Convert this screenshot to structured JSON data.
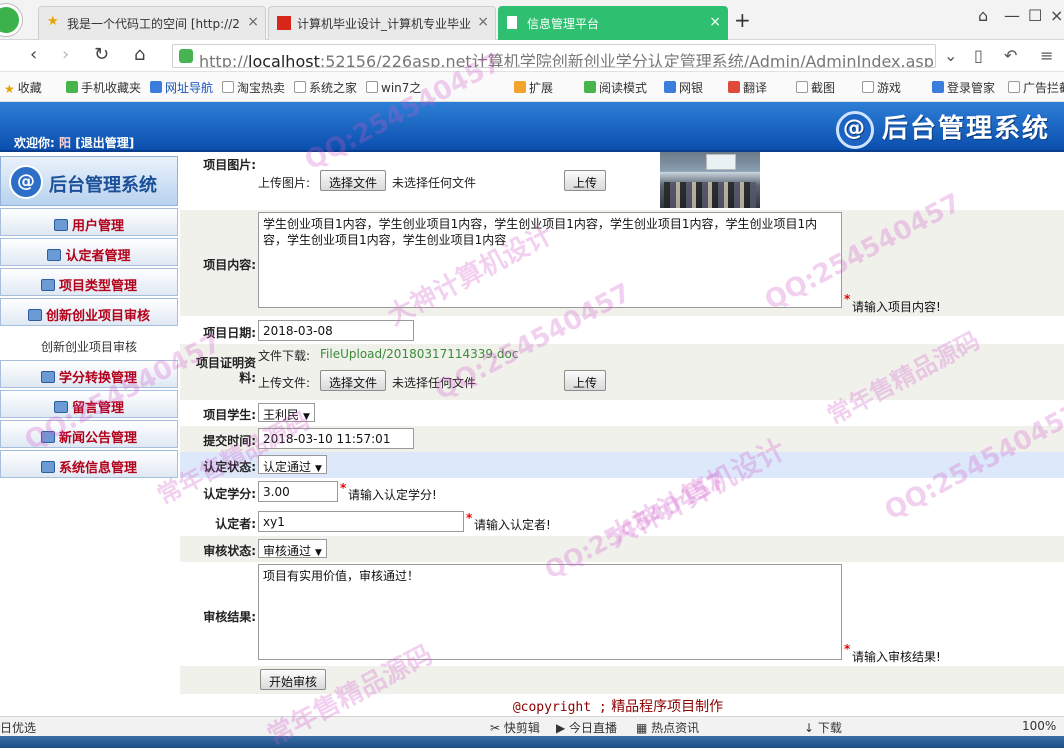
{
  "browser": {
    "tabs": [
      {
        "label": "我是一个代码工的空间 [http://2",
        "active": false
      },
      {
        "label": "计算机毕业设计_计算机专业毕业",
        "active": false
      },
      {
        "label": "信息管理平台",
        "active": true
      }
    ],
    "url_prefix": "http://",
    "url_host": "localhost",
    "url_rest": ":52156/226asp.net计算机学院创新创业学分认定管理系统/Admin/AdminIndex.aspx",
    "bookmarks": [
      "收藏",
      "手机收藏夹",
      "网址导航",
      "淘宝热卖",
      "系统之家",
      "win7之",
      "扩展",
      "阅读模式",
      "网银",
      "翻译",
      "截图",
      "游戏",
      "登录管家",
      "广告拦截"
    ]
  },
  "header": {
    "welcome_label": "欢迎你:",
    "username": "阳",
    "logout": "[退出管理]",
    "brand_title": "后台管理系统"
  },
  "sidebar": {
    "brand_title": "后台管理系统",
    "items": [
      {
        "label": "用户管理"
      },
      {
        "label": "认定者管理"
      },
      {
        "label": "项目类型管理"
      },
      {
        "label": "创新创业项目审核"
      },
      {
        "label": "创新创业项目审核",
        "sub": true
      },
      {
        "label": "学分转换管理"
      },
      {
        "label": "留言管理"
      },
      {
        "label": "新闻公告管理"
      },
      {
        "label": "系统信息管理"
      }
    ]
  },
  "form": {
    "image": {
      "label": "项目图片:",
      "upload_label": "上传图片:",
      "choose_btn": "选择文件",
      "no_file": "未选择任何文件",
      "upload_btn": "上传"
    },
    "content": {
      "label": "项目内容:",
      "value": "学生创业项目1内容，学生创业项目1内容，学生创业项目1内容，学生创业项目1内容，学生创业项目1内容，学生创业项目1内容，学生创业项目1内容",
      "hint": "请输入项目内容!"
    },
    "date": {
      "label": "项目日期:",
      "value": "2018-03-08"
    },
    "proof": {
      "label": "项目证明资料:",
      "download_label": "文件下载:",
      "download_link": "FileUpload/20180317114339.doc",
      "upload_label": "上传文件:",
      "choose_btn": "选择文件",
      "no_file": "未选择任何文件",
      "upload_btn": "上传"
    },
    "student": {
      "label": "项目学生:",
      "value": "王利民"
    },
    "submit_time": {
      "label": "提交时间:",
      "value": "2018-03-10 11:57:01"
    },
    "cert_status": {
      "label": "认定状态:",
      "value": "认定通过"
    },
    "credits": {
      "label": "认定学分:",
      "value": "3.00",
      "hint": "请输入认定学分!"
    },
    "certifier": {
      "label": "认定者:",
      "value": "xy1",
      "hint": "请输入认定者!"
    },
    "review_status": {
      "label": "审核状态:",
      "value": "审核通过"
    },
    "review_result": {
      "label": "审核结果:",
      "value": "项目有实用价值，审核通过！",
      "hint": "请输入审核结果!"
    },
    "submit_btn": "开始审核",
    "required_mark": "*"
  },
  "footer": {
    "copyright_code": "@copyright ;",
    "copyright_text": "精品程序项目制作"
  },
  "statusbar": {
    "left": "日优选",
    "items": [
      "快剪辑",
      "今日直播",
      "热点资讯",
      "下载",
      "100%"
    ]
  },
  "watermarks": {
    "qq": "QQ:254540457",
    "design": "大神计算机设计",
    "source": "常年售精品源码"
  },
  "colors": {
    "header_blue": "#0b4fae",
    "menu_red": "#b3001a",
    "active_tab_green": "#2fbf71",
    "link_green": "#3a8b3a",
    "required_red": "#e00000"
  }
}
